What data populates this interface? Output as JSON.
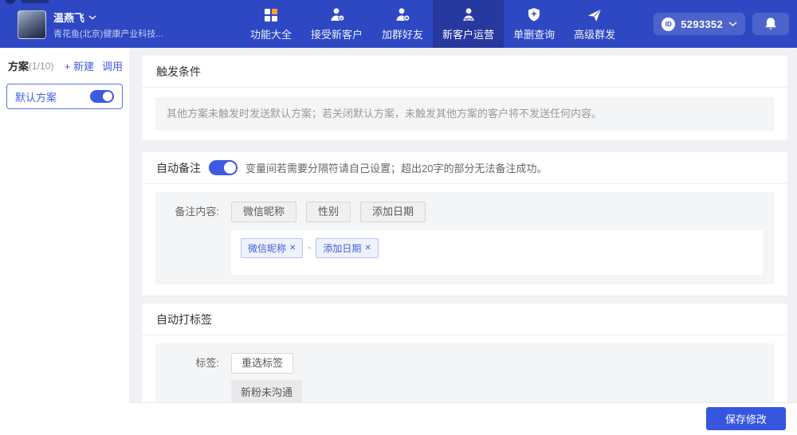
{
  "header": {
    "user": {
      "name": "温燕飞",
      "company": "青花鱼(北京)健康产业科技..."
    },
    "nav": [
      {
        "label": "功能大全",
        "active": false
      },
      {
        "label": "接受新客户",
        "active": false
      },
      {
        "label": "加群好友",
        "active": false
      },
      {
        "label": "新客户运营",
        "active": true
      },
      {
        "label": "单删查询",
        "active": false
      },
      {
        "label": "高级群发",
        "active": false
      }
    ],
    "id_badge": {
      "prefix": "ID",
      "value": "5293352"
    }
  },
  "sidebar": {
    "title": "方案",
    "count": "(1/10)",
    "new_label": "+ 新建",
    "invoke_label": "调用",
    "plan": {
      "name": "默认方案",
      "enabled": true
    }
  },
  "main": {
    "trigger_section": {
      "title": "触发条件",
      "info": "其他方案未触发时发送默认方案；若关闭默认方案，未触发其他方案的客户将不发送任何内容。"
    },
    "auto_remark_section": {
      "title": "自动备注",
      "enabled": true,
      "note": "变量间若需要分隔符请自己设置；超出20字的部分无法备注成功。",
      "content_label": "备注内容:",
      "variable_options": [
        "微信昵称",
        "性别",
        "添加日期"
      ],
      "selected_variables": [
        "微信昵称",
        "添加日期"
      ],
      "separator": "-",
      "close_glyph": "✕"
    },
    "auto_tag_section": {
      "title": "自动打标签",
      "tag_label": "标签:",
      "reselect_button": "重选标签",
      "tags": [
        "新粉未沟通"
      ]
    }
  },
  "footer": {
    "save_button": "保存修改"
  },
  "colors": {
    "nav_blue": "#2e48c4",
    "nav_active": "#27389f",
    "accent_blue": "#3d5ae0",
    "save_blue": "#3656e0",
    "grid_icon_orange": "#ffa22d",
    "page_bg": "#f0f1f4",
    "panel_gray": "#f4f5f7"
  }
}
